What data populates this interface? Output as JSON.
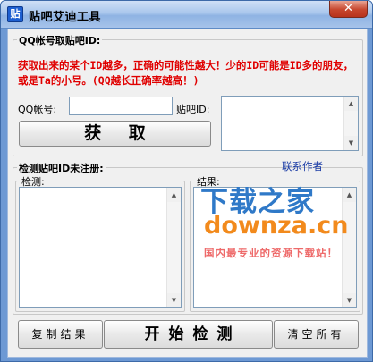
{
  "window": {
    "title": "贴吧艾迪工具",
    "icon_glyph": "贴",
    "close_glyph": "✕"
  },
  "section1": {
    "legend": "QQ帐号取贴吧ID:",
    "note": "获取出来的某个ID越多，正确的可能性越大！少的ID可能是ID多的朋友，或是Ta的小号。(QQ越长正确率越高！)",
    "qq_label": "QQ帐号:",
    "qq_value": "",
    "tieba_id_label": "贴吧ID:",
    "fetch_button": "获 取"
  },
  "section2": {
    "legend": "检测贴吧ID未注册:",
    "contact_link": "联系作者",
    "detect_legend": "检测:",
    "result_legend": "结果:"
  },
  "buttons": {
    "copy_result": "复制结果",
    "start_detect": "开始检测",
    "clear_all": "清空所有"
  },
  "watermark": {
    "cn": "下载之家",
    "en": "downza.cn",
    "sub": "国内最专业的资源下载站！"
  },
  "scrollbar": {
    "up_glyph": "▲",
    "down_glyph": "▼"
  }
}
